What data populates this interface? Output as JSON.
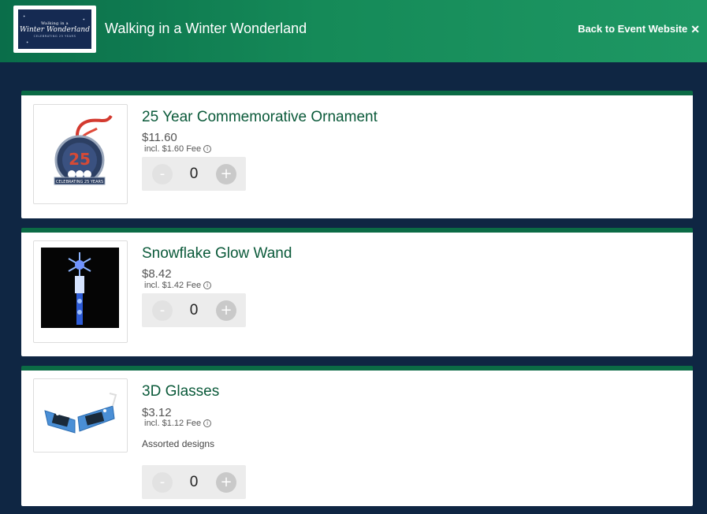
{
  "header": {
    "logo": {
      "line1": "Walking in a",
      "line2": "Winter Wonderland",
      "line3": "CELEBRATING 25 YEARS"
    },
    "title": "Walking in a Winter Wonderland",
    "back_label": "Back to Event Website",
    "close_glyph": "✕"
  },
  "products": [
    {
      "name": "25 Year Commemorative Ornament",
      "price": "$11.60",
      "fee": "incl. $1.60 Fee",
      "quantity": "0",
      "image": "ornament-image"
    },
    {
      "name": "Snowflake Glow Wand",
      "price": "$8.42",
      "fee": "incl. $1.42 Fee",
      "quantity": "0",
      "image": "glow-wand-image"
    },
    {
      "name": "3D Glasses",
      "price": "$3.12",
      "fee": "incl. $1.12 Fee",
      "description": "Assorted designs",
      "quantity": "0",
      "image": "3d-glasses-image"
    }
  ],
  "stepper": {
    "minus": "-",
    "plus": "+"
  },
  "info_glyph": "i",
  "colors": {
    "header_green": "#158a58",
    "card_accent": "#0b6b45",
    "page_bg": "#0f2643",
    "product_name": "#0b5a3a"
  }
}
